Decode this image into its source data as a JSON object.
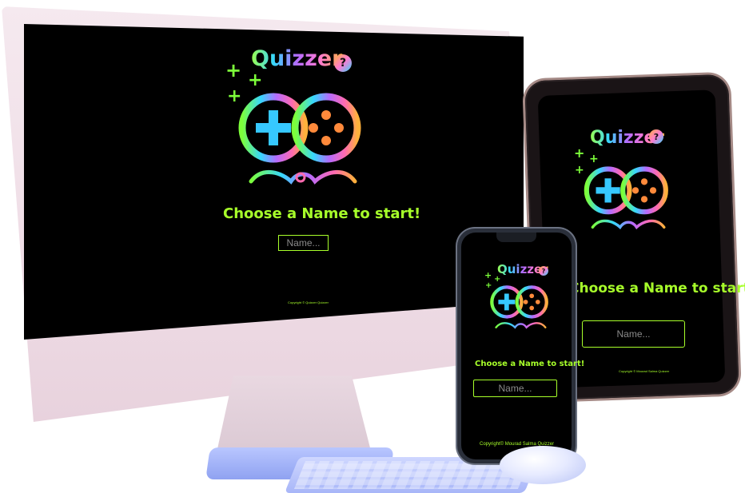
{
  "app": {
    "title": "Quizzer",
    "badge_symbol": "?",
    "prompt": "Choose a Name to start!",
    "name_placeholder": "Name...",
    "copyright_desktop": "Copyright © Quizzer Quizzer",
    "copyright_tablet": "Copyright © Mourad Salma Quizzer",
    "copyright_phone": "Copyright© Mourad Salma Quizzer",
    "plus_glyph": "+"
  },
  "colors": {
    "accent": "#a7ff2a",
    "screen_bg": "#000000",
    "monitor_shell": "#f2e4ea",
    "keyboard": "#b9c6ff"
  },
  "icons": {
    "logo": "gamepad-infinity-logo-icon",
    "sparkle": "plus-sparkle-icon",
    "badge": "question-bubble-icon"
  }
}
